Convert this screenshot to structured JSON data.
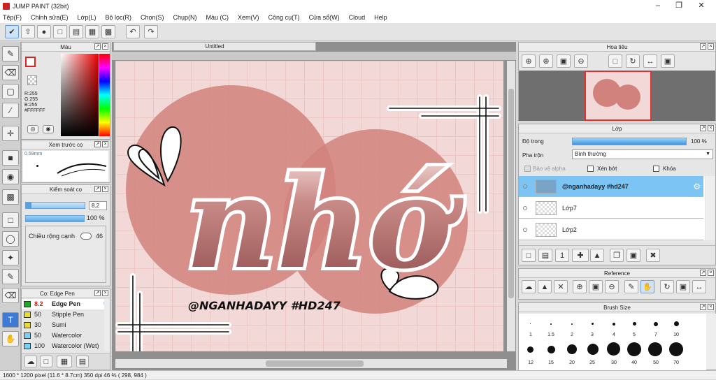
{
  "app": {
    "title": "JUMP PAINT (32bit)"
  },
  "menu": [
    "Tệp(F)",
    "Chỉnh sửa(E)",
    "Lớp(L)",
    "Bộ lọc(R)",
    "Chọn(S)",
    "Chụp(N)",
    "Màu (C)",
    "Xem(V)",
    "Công cụ(T)",
    "Cửa sổ(W)",
    "Cloud",
    "Help"
  ],
  "color_panel": {
    "title": "Màu",
    "r": "R:255",
    "g": "G:255",
    "b": "B:255",
    "hex": "#FFFFFF"
  },
  "brush_preview": {
    "title": "Xem trước cọ",
    "size": "0.59mm"
  },
  "brush_control": {
    "title": "Kiểm soát cọ",
    "size_value": "8.2",
    "opacity_value": "100 %",
    "edge_label": "Chiều rộng cạnh",
    "edge_value": "46",
    "size_fill": 0.1,
    "opacity_fill": 1.0
  },
  "brush_list": {
    "title": "Cọ: Edge Pen",
    "items": [
      {
        "size": "8.2",
        "name": "Edge Pen",
        "color": "#22a52a"
      },
      {
        "size": "50",
        "name": "Stipple Pen",
        "color": "#e8de2a"
      },
      {
        "size": "30",
        "name": "Sumi",
        "color": "#e8de2a"
      },
      {
        "size": "50",
        "name": "Watercolor",
        "color": "#79d2ef"
      },
      {
        "size": "100",
        "name": "Watercolor (Wet)",
        "color": "#79d2ef"
      }
    ]
  },
  "canvas": {
    "tab": "Untitled",
    "art_title": "nhớ",
    "watermark": "@NGANHADAYY #HD247"
  },
  "navigator": {
    "title": "Hoa tiêu"
  },
  "layer_panel": {
    "title": "Lớp",
    "opacity_label": "Độ trong",
    "opacity_value": "100 %",
    "opacity_fill": 1.0,
    "blend_label": "Pha trộn",
    "blend_value": "Bình thường",
    "protect_alpha": "Bảo vệ alpha",
    "clipping": "Xén bớt",
    "lock": "Khóa",
    "layers": [
      {
        "name": "@nganhadayy #hd247"
      },
      {
        "name": "Lớp7"
      },
      {
        "name": "Lớp2"
      }
    ]
  },
  "reference": {
    "title": "Reference"
  },
  "brush_size": {
    "title": "Brush Size",
    "row1": [
      "1",
      "1.5",
      "2",
      "3",
      "4",
      "5",
      "7",
      "10"
    ],
    "row2": [
      "12",
      "15",
      "20",
      "25",
      "30",
      "40",
      "50",
      "70"
    ]
  },
  "status": {
    "text": "1600 * 1200 pixel   (11.6 * 8.7cm)   350 dpi   46 %   ( 298, 984 )"
  }
}
